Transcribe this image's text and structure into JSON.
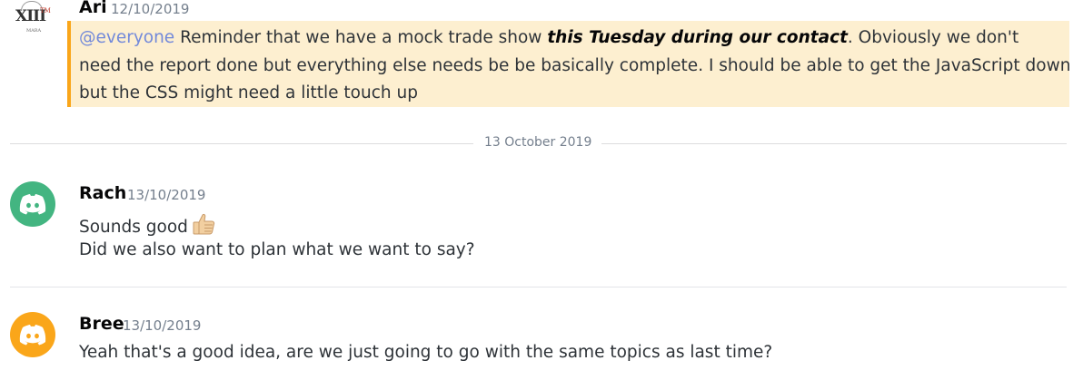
{
  "messages": [
    {
      "author": "Ari",
      "timestamp": "12/10/2019",
      "avatar": "ari-logo-icon",
      "avatar_text": {
        "mark": "XIII",
        "tm": "TM",
        "sub": "MARA"
      },
      "highlighted": true,
      "lines": {
        "line1_mention": "@everyone",
        "line1_a": " Reminder that we have a mock trade show ",
        "line1_emphasis": "this Tuesday during our contact",
        "line1_b": ". Obviously we don't",
        "line2": "need the report done but everything else needs be be basically complete. I should be able to get the JavaScript down",
        "line3": "but the CSS might need a little touch up"
      }
    },
    {
      "author": "Rach",
      "timestamp": "13/10/2019",
      "avatar": "discord-logo-icon",
      "avatar_color": "#43b581",
      "lines": {
        "line1": "Sounds good",
        "line1_emoji": "thumbs-up-icon",
        "line2": "Did we also want to plan what we want to say?"
      }
    },
    {
      "author": "Bree",
      "timestamp": "13/10/2019",
      "avatar": "discord-logo-icon",
      "avatar_color": "#faa61a",
      "lines": {
        "line1": "Yeah that's a good idea, are we just going to go with the same topics as last time?"
      }
    }
  ],
  "day_divider": "13 October 2019",
  "colors": {
    "mention": "#7289da",
    "highlight_bg": "#fdefd0",
    "highlight_border": "#faa61a",
    "timestamp": "#747f8d"
  }
}
